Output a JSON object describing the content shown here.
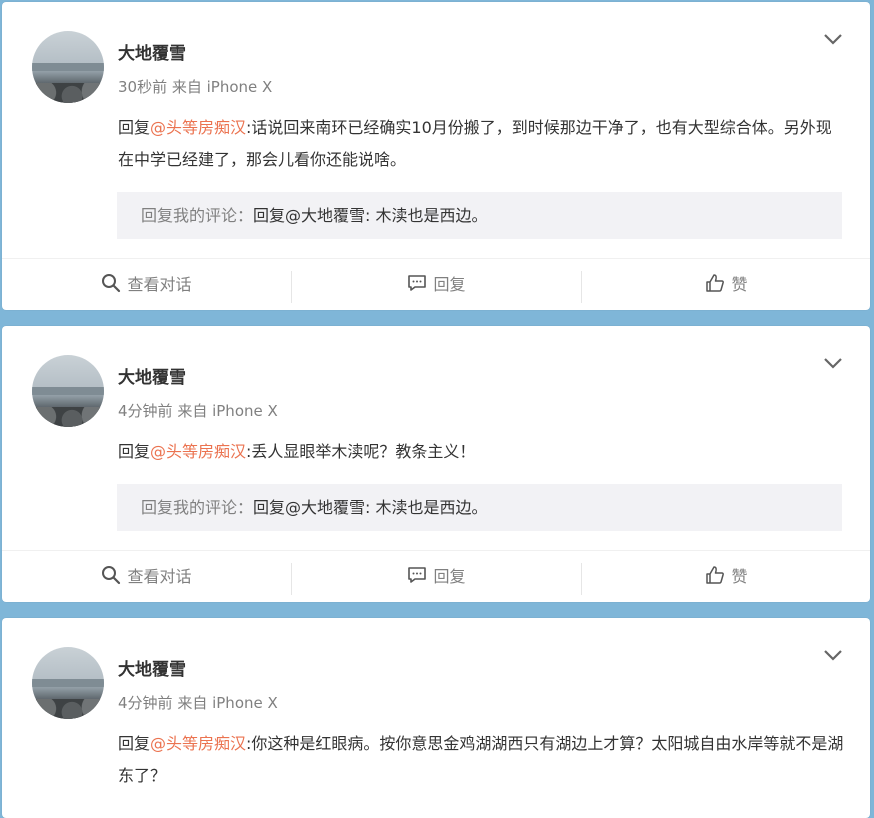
{
  "posts": [
    {
      "author": "大地覆雪",
      "time": "30秒前",
      "source": "来自 iPhone X",
      "reply_prefix": "回复",
      "mention": "@头等房痴汉",
      "body": ":话说回来南环已经确实10月份搬了，到时候那边干净了，也有大型综合体。另外现在中学已经建了，那会儿看你还能说啥。",
      "quote_label": "回复我的评论：",
      "quote_text": "回复@大地覆雪: 木渎也是西边。",
      "actions": [
        "查看对话",
        "回复",
        "赞"
      ]
    },
    {
      "author": "大地覆雪",
      "time": "4分钟前",
      "source": "来自 iPhone X",
      "reply_prefix": "回复",
      "mention": "@头等房痴汉",
      "body": ":丢人显眼举木渎呢？教条主义！",
      "quote_label": "回复我的评论：",
      "quote_text": "回复@大地覆雪: 木渎也是西边。",
      "actions": [
        "查看对话",
        "回复",
        "赞"
      ]
    },
    {
      "author": "大地覆雪",
      "time": "4分钟前",
      "source": "来自 iPhone X",
      "reply_prefix": "回复",
      "mention": "@头等房痴汉",
      "body": ":你这种是红眼病。按你意思金鸡湖湖西只有湖边上才算？太阳城自由水岸等就不是湖东了？"
    }
  ],
  "colors": {
    "mention": "#eb7350",
    "background": "#7fb6d8",
    "quote_bg": "#f2f2f5"
  },
  "icons": {
    "expand": "chevron-down-icon",
    "view": "search-icon",
    "reply": "comment-icon",
    "like": "thumbs-up-icon"
  }
}
